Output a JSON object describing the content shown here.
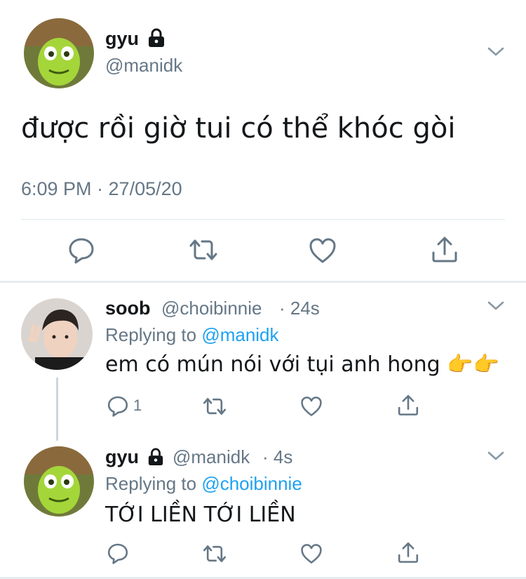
{
  "main_tweet": {
    "display_name": "gyu",
    "handle": "@manidk",
    "text": "được rồi giờ tui có thể khóc gòi",
    "timestamp": "6:09 PM · 27/05/20",
    "icons": [
      "lock-icon",
      "chevron-down-icon",
      "reply-icon",
      "retweet-icon",
      "like-icon",
      "share-icon"
    ]
  },
  "replies": [
    {
      "display_name": "soob",
      "handle": "@choibinnie",
      "time": "· 24s",
      "replying_prefix": "Replying to",
      "replying_to": "@manidk",
      "text": "em có mún nói với tụi anh hong",
      "emoji": "👉👉",
      "reply_count": "1"
    },
    {
      "display_name": "gyu",
      "handle": "@manidk",
      "time": "· 4s",
      "replying_prefix": "Replying to",
      "replying_to": "@choibinnie",
      "text": "TỚI LIỀN TỚI LIỀN"
    }
  ],
  "colors": {
    "accent": "#1da1f2",
    "secondary_text": "#657786",
    "divider": "#e6ecf0",
    "icon": "#657786"
  }
}
